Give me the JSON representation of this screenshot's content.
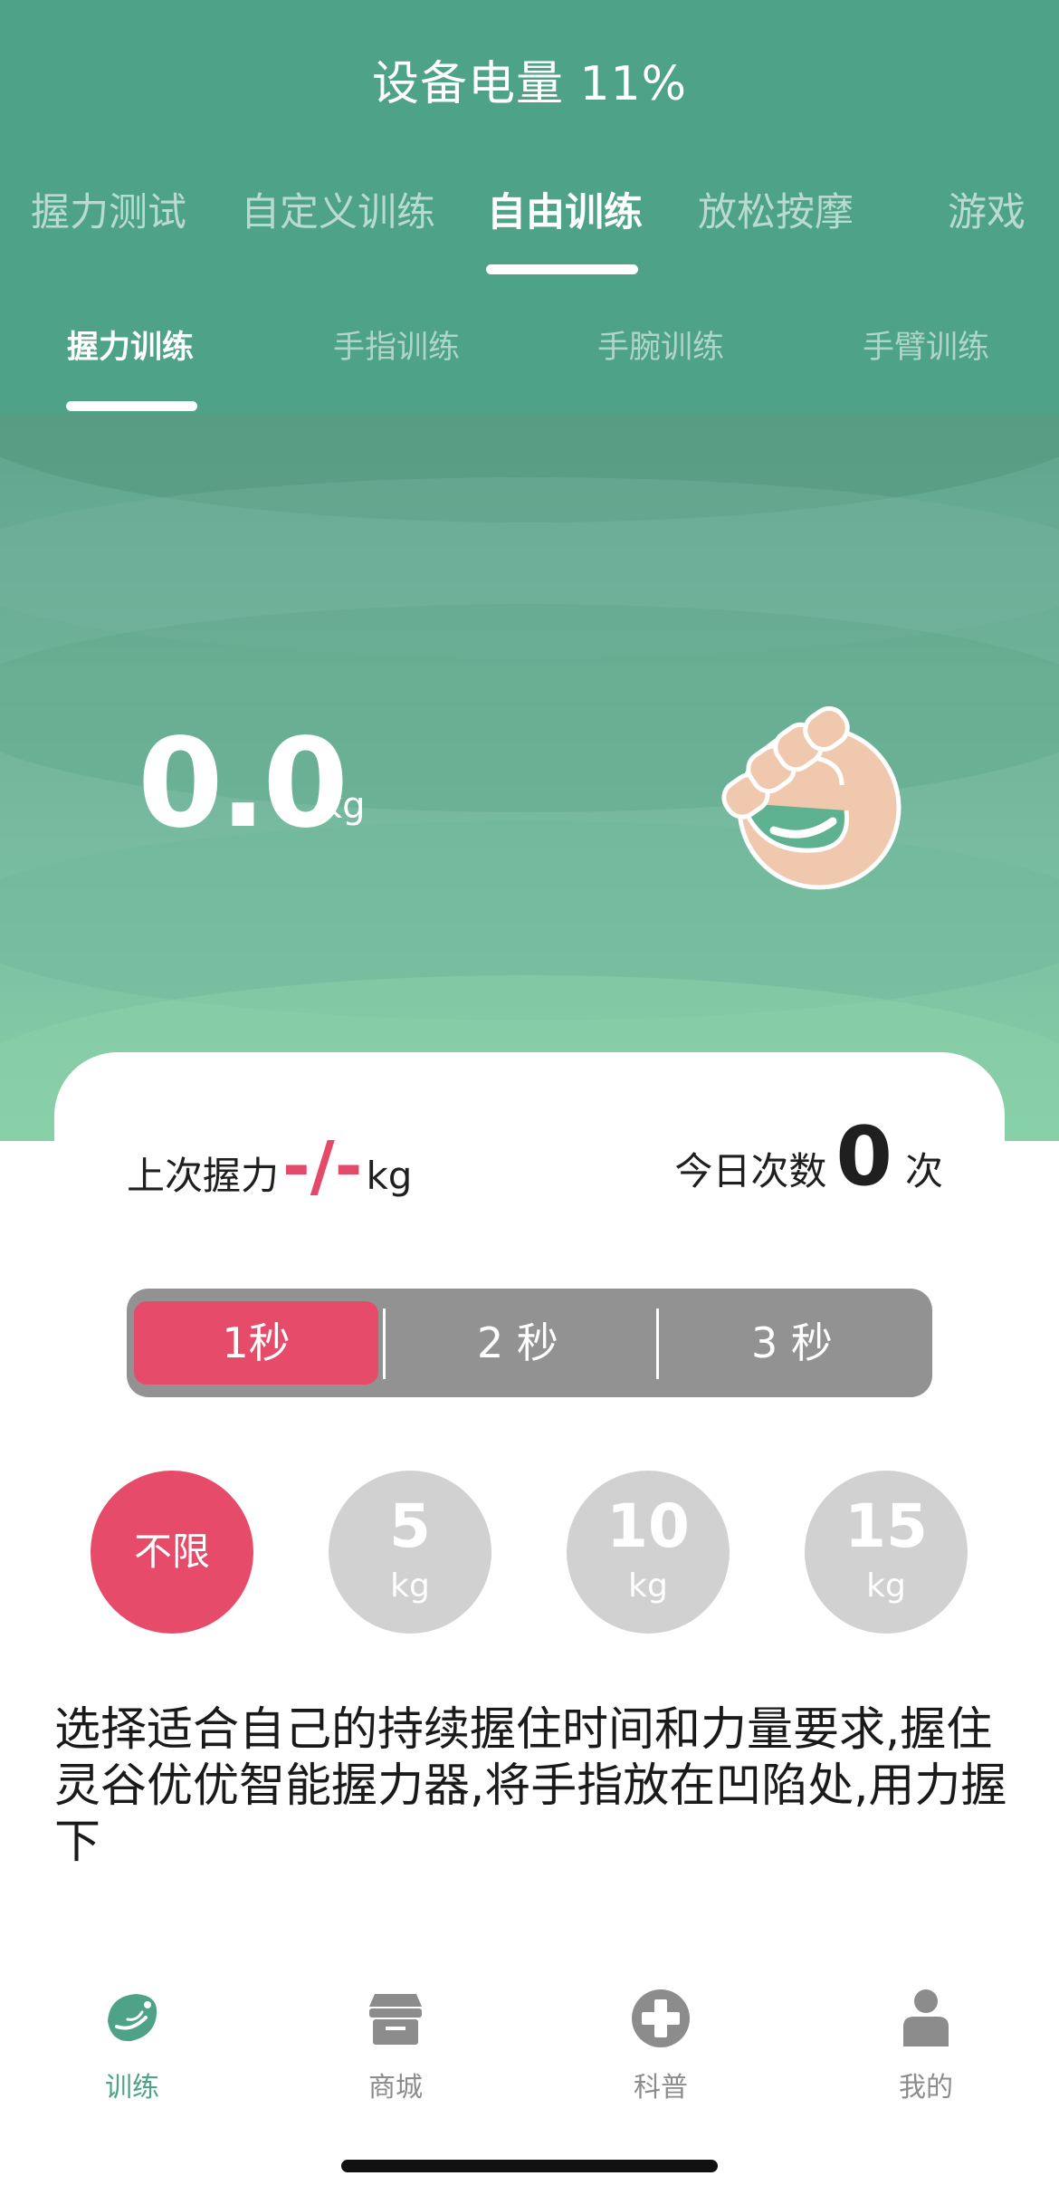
{
  "header": {
    "battery_text": "设备电量 11%",
    "main_tabs": [
      {
        "label": "握力测试",
        "active": false
      },
      {
        "label": "自定义训练",
        "active": false
      },
      {
        "label": "自由训练",
        "active": true
      },
      {
        "label": "放松按摩",
        "active": false
      },
      {
        "label": "游戏",
        "active": false
      }
    ],
    "sub_tabs": [
      {
        "label": "握力训练",
        "active": true
      },
      {
        "label": "手指训练",
        "active": false
      },
      {
        "label": "手腕训练",
        "active": false
      },
      {
        "label": "手臂训练",
        "active": false
      }
    ]
  },
  "hero": {
    "force_value": "0.0",
    "force_unit": "kg",
    "icon": "fist-grip-icon"
  },
  "stats": {
    "last_grip_label": "上次握力",
    "last_grip_value": "-/-",
    "last_grip_unit": "kg",
    "today_count_label": "今日次数",
    "today_count_value": "0",
    "today_count_unit": "次"
  },
  "duration_options": [
    {
      "label": "1秒",
      "selected": true
    },
    {
      "label": "2 秒",
      "selected": false
    },
    {
      "label": "3 秒",
      "selected": false
    }
  ],
  "force_options": [
    {
      "label": "不限",
      "unit": "",
      "selected": true
    },
    {
      "label": "5",
      "unit": "kg",
      "selected": false
    },
    {
      "label": "10",
      "unit": "kg",
      "selected": false
    },
    {
      "label": "15",
      "unit": "kg",
      "selected": false
    }
  ],
  "description": "选择适合自己的持续握住时间和力量要求,握住灵谷优优智能握力器,将手指放在凹陷处,用力握下",
  "bottom_nav": [
    {
      "label": "训练",
      "icon": "leaf-logo-icon",
      "active": true
    },
    {
      "label": "商城",
      "icon": "store-icon",
      "active": false
    },
    {
      "label": "科普",
      "icon": "medical-cross-icon",
      "active": false
    },
    {
      "label": "我的",
      "icon": "user-icon",
      "active": false
    }
  ],
  "colors": {
    "primary_green": "#4ea287",
    "accent_red": "#e64c69",
    "segment_gray": "#929292",
    "circle_gray": "#d1d1d1"
  }
}
